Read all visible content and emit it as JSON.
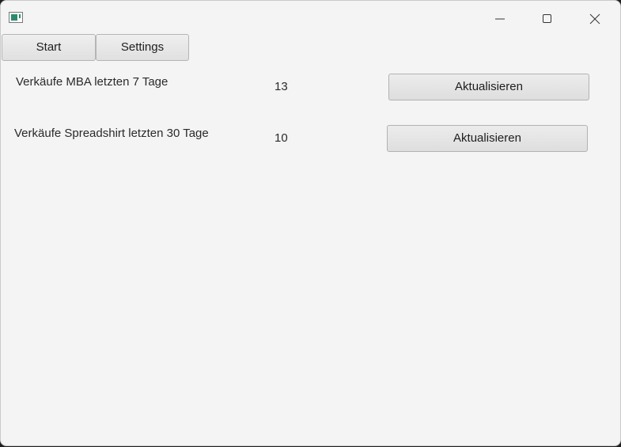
{
  "window": {
    "icon": "app-window-icon",
    "controls": [
      "minimize-icon",
      "maximize-icon",
      "close-icon"
    ]
  },
  "tabs": [
    {
      "label": "Start"
    },
    {
      "label": "Settings"
    }
  ],
  "stats": [
    {
      "label": "Verkäufe MBA letzten 7 Tage",
      "value": "13",
      "button": "Aktualisieren"
    },
    {
      "label": "Verkäufe Spreadshirt letzten 30 Tage",
      "value": "10",
      "button": "Aktualisieren"
    }
  ]
}
